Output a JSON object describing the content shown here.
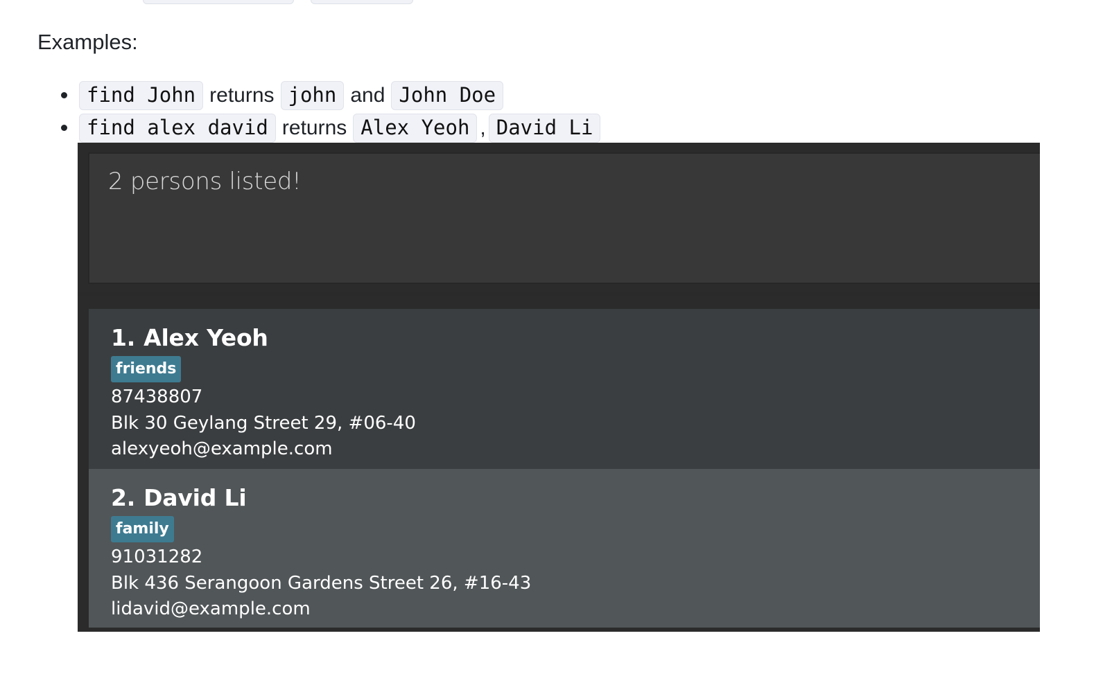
{
  "examples_label": "Examples:",
  "examples": [
    {
      "parts": [
        {
          "type": "code",
          "text": "find John"
        },
        {
          "type": "text",
          "text": "returns"
        },
        {
          "type": "code",
          "text": "john"
        },
        {
          "type": "text",
          "text": "and"
        },
        {
          "type": "code",
          "text": "John Doe"
        }
      ]
    },
    {
      "parts": [
        {
          "type": "code",
          "text": "find alex david"
        },
        {
          "type": "text",
          "text": "returns"
        },
        {
          "type": "code",
          "text": "Alex Yeoh"
        },
        {
          "type": "text",
          "text": ","
        },
        {
          "type": "code",
          "text": "David Li"
        }
      ]
    }
  ],
  "app": {
    "result_message": "2 persons listed!",
    "persons": [
      {
        "index": "1.",
        "name": "Alex Yeoh",
        "tag": "friends",
        "phone": "87438807",
        "address": "Blk 30 Geylang Street 29, #06-40",
        "email": "alexyeoh@example.com"
      },
      {
        "index": "2.",
        "name": "David Li",
        "tag": "family",
        "phone": "91031282",
        "address": "Blk 436 Serangoon Gardens Street 26, #16-43",
        "email": "lidavid@example.com"
      }
    ],
    "colors": {
      "background": "#2b2b2b",
      "result_box": "#383838",
      "card_odd": "#3b3e40",
      "card_even": "#515658",
      "tag": "#3e7b91"
    }
  }
}
